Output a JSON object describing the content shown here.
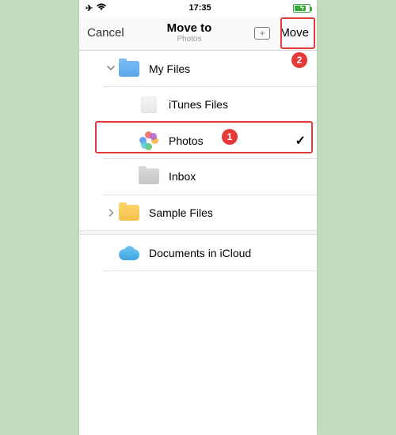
{
  "statusbar": {
    "time": "17:35"
  },
  "nav": {
    "cancel": "Cancel",
    "title": "Move to",
    "subtitle": "Photos",
    "move": "Move"
  },
  "rows": {
    "myfiles": "My Files",
    "itunes": "iTunes Files",
    "photos": "Photos",
    "inbox": "Inbox",
    "sample": "Sample Files",
    "icloud": "Documents in iCloud"
  },
  "callouts": {
    "one": "1",
    "two": "2"
  }
}
